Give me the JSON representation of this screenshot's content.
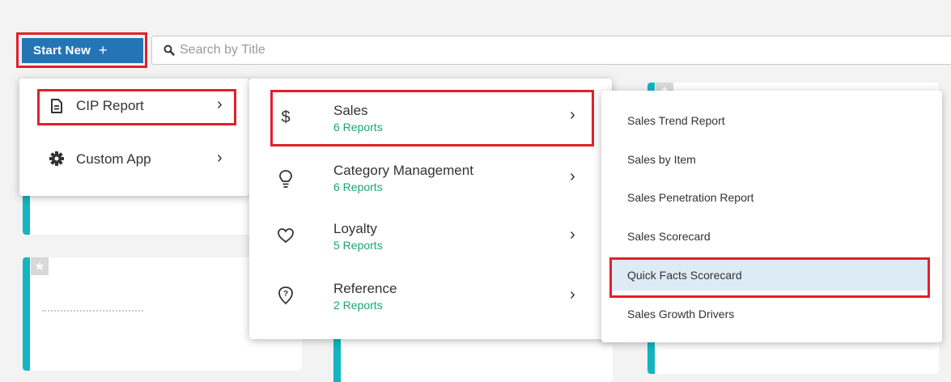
{
  "toolbar": {
    "start_new_label": "Start New",
    "start_new_plus": "+",
    "search_placeholder": "Search by Title"
  },
  "menu_level1": {
    "items": [
      {
        "label": "CIP Report",
        "icon": "document-icon"
      },
      {
        "label": "Custom App",
        "icon": "gear-icon"
      }
    ]
  },
  "menu_level2": {
    "items": [
      {
        "title": "Sales",
        "subtitle": "6 Reports",
        "icon": "dollar-icon"
      },
      {
        "title": "Category Management",
        "subtitle": "6 Reports",
        "icon": "lightbulb-icon"
      },
      {
        "title": "Loyalty",
        "subtitle": "5 Reports",
        "icon": "heart-icon"
      },
      {
        "title": "Reference",
        "subtitle": "2 Reports",
        "icon": "question-marker-icon"
      }
    ]
  },
  "menu_level3": {
    "items": [
      {
        "label": "Sales Trend Report"
      },
      {
        "label": "Sales by Item"
      },
      {
        "label": "Sales Penetration Report"
      },
      {
        "label": "Sales Scorecard"
      },
      {
        "label": "Quick Facts Scorecard"
      },
      {
        "label": "Sales Growth Drivers"
      }
    ]
  },
  "colors": {
    "primary_button": "#2475b6",
    "highlight_border": "#e2202c",
    "report_count": "#1aa672",
    "card_accent": "#12b5c0",
    "active_item_bg": "#ddebf7"
  }
}
